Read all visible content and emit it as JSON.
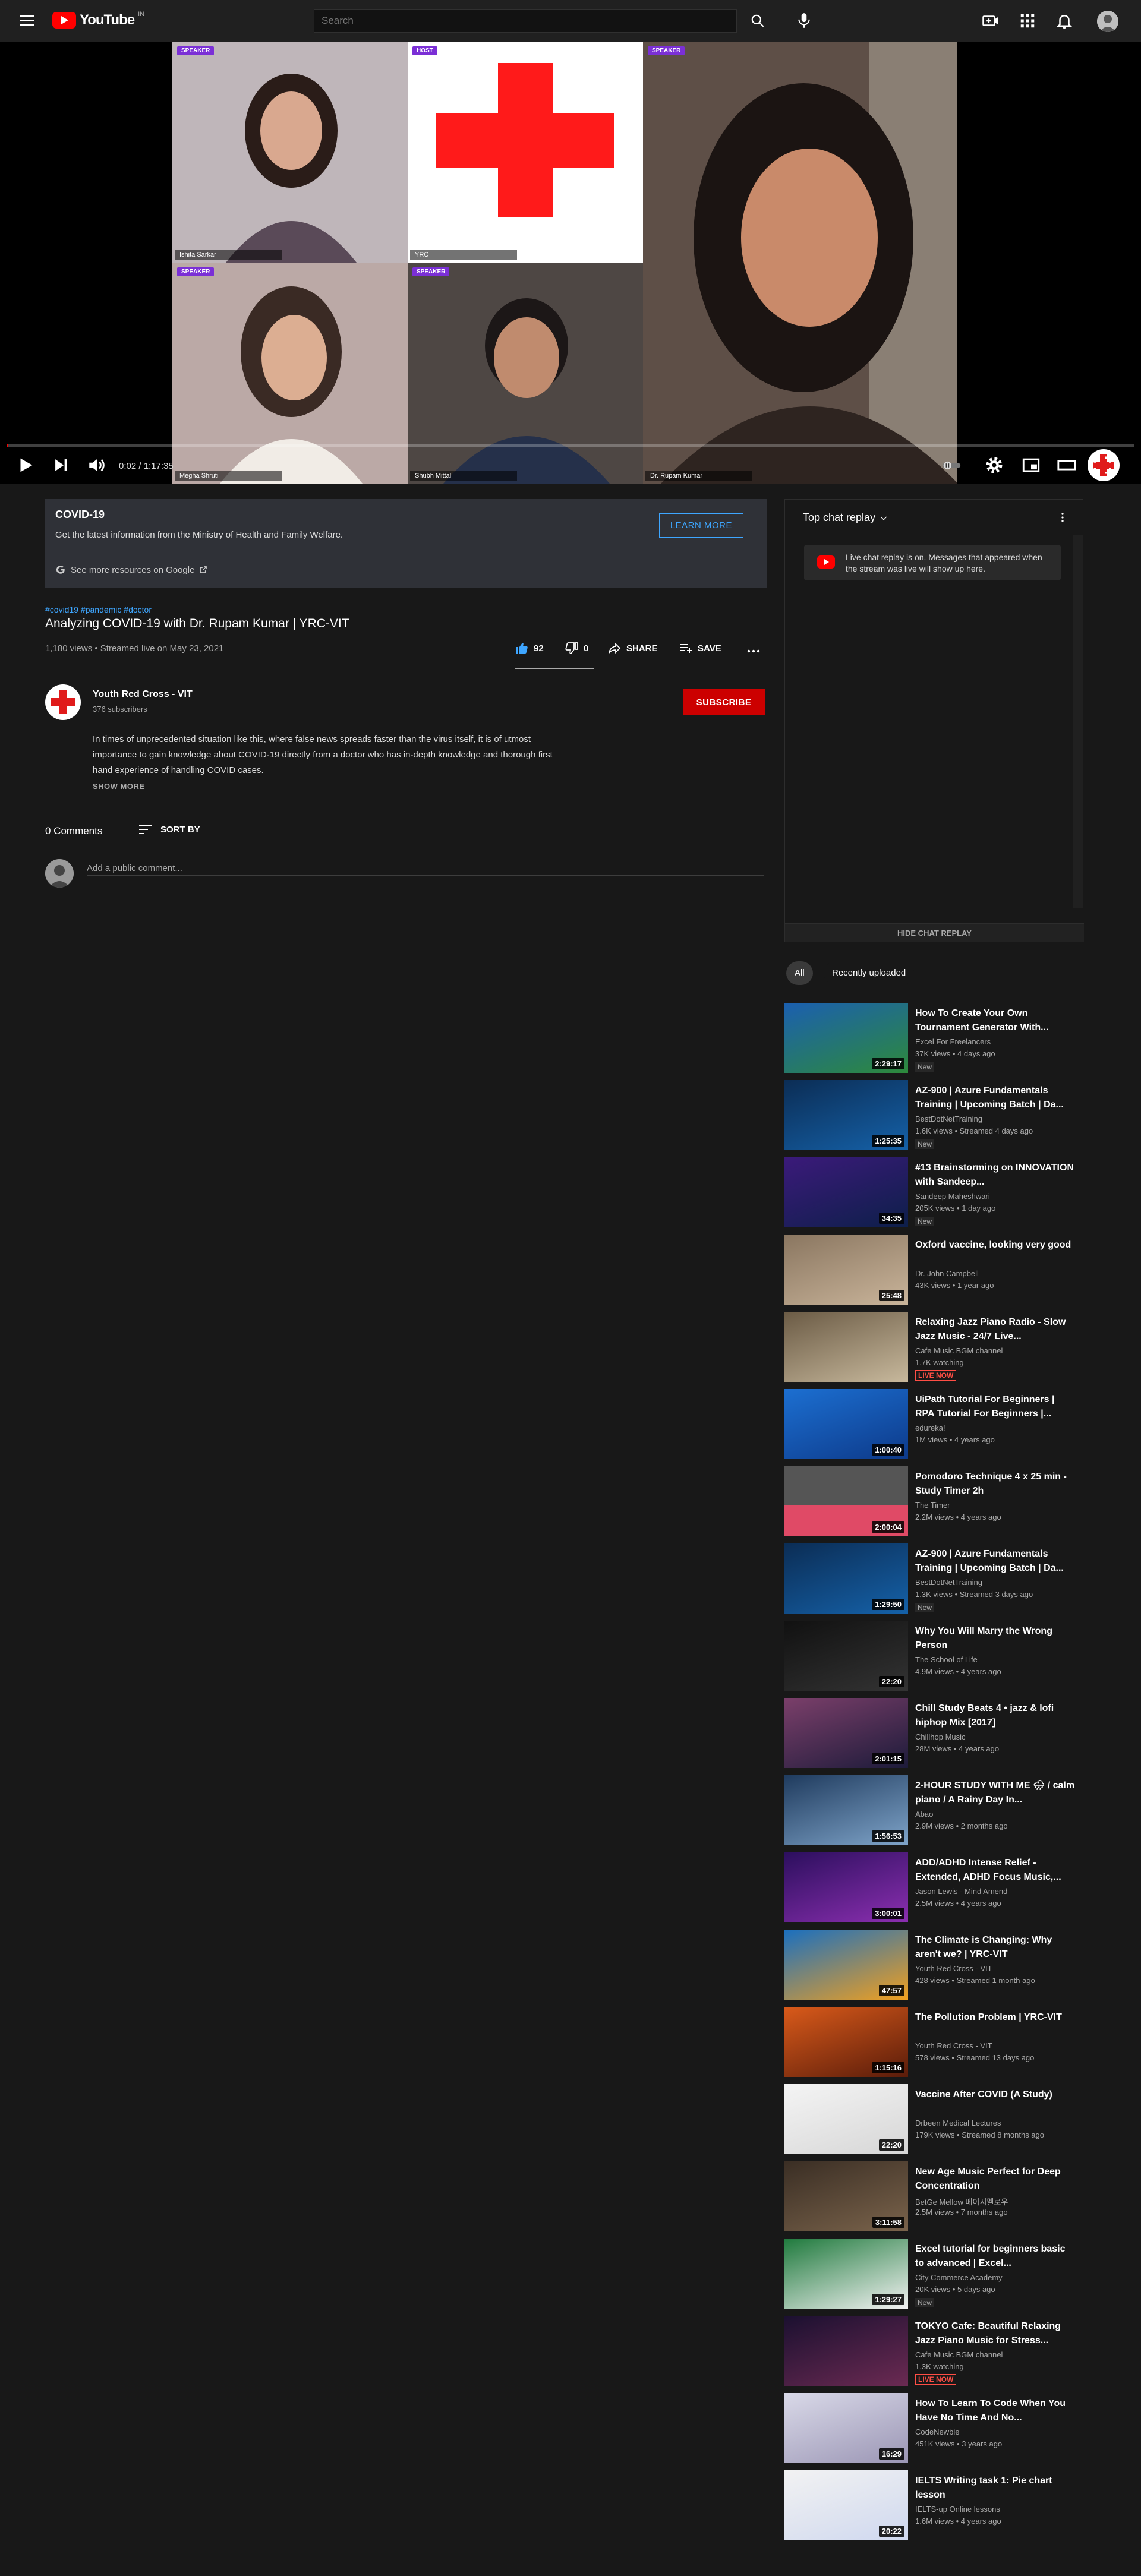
{
  "header": {
    "logo_text": "YouTube",
    "country_code": "IN",
    "search_placeholder": "Search"
  },
  "player": {
    "tiles": [
      {
        "badge": "SPEAKER",
        "name": "Ishita Sarkar"
      },
      {
        "badge": "HOST",
        "name": "YRC"
      },
      {
        "badge": "SPEAKER",
        "name": "Dr. Rupam Kumar"
      },
      {
        "badge": "SPEAKER",
        "name": "Megha Shruti"
      },
      {
        "badge": "SPEAKER",
        "name": "Shubh Mittal"
      }
    ],
    "time": "0:02 / 1:17:35",
    "progress_fraction": 0.0004
  },
  "covid_panel": {
    "title": "COVID-19",
    "description": "Get the latest information from the Ministry of Health and Family Welfare.",
    "button": "LEARN MORE",
    "google_link": "See more resources on Google"
  },
  "video": {
    "hashtags": "#covid19 #pandemic #doctor",
    "title": "Analyzing COVID-19 with Dr. Rupam Kumar | YRC-VIT",
    "views": "1,180 views • Streamed live on May 23, 2021",
    "likes": "92",
    "dislikes": "0",
    "share": "SHARE",
    "save": "SAVE",
    "like_ratio": 1.0
  },
  "channel": {
    "name": "Youth Red Cross - VIT",
    "subscribers": "376 subscribers",
    "subscribe": "SUBSCRIBE",
    "description": "In times of unprecedented situation like this, where false news spreads faster than the virus itself, it is of utmost importance to gain knowledge about COVID-19 directly from a doctor who has in-depth knowledge and thorough first hand experience of handling COVID cases.",
    "show_more": "SHOW MORE"
  },
  "comments": {
    "count": "0 Comments",
    "sort_by": "SORT BY",
    "placeholder": "Add a public comment..."
  },
  "chat": {
    "title": "Top chat replay",
    "notice": "Live chat replay is on. Messages that appeared when the stream was live will show up here.",
    "hide": "HIDE CHAT REPLAY"
  },
  "chips": {
    "all": "All",
    "recent": "Recently uploaded"
  },
  "recommendations": [
    {
      "title": "How To Create Your Own Tournament Generator With...",
      "channel": "Excel For Freelancers",
      "meta": "37K views • 4 days ago",
      "tag": "New",
      "duration": "2:29:17"
    },
    {
      "title": "AZ-900 | Azure Fundamentals Training | Upcoming Batch | Da...",
      "channel": "BestDotNetTraining",
      "meta": "1.6K views • Streamed 4 days ago",
      "tag": "New",
      "duration": "1:25:35"
    },
    {
      "title": "#13 Brainstorming on INNOVATION with Sandeep...",
      "channel": "Sandeep Maheshwari",
      "meta": "205K views • 1 day ago",
      "tag": "New",
      "duration": "34:35"
    },
    {
      "title": "Oxford vaccine, looking very good",
      "channel": "Dr. John Campbell",
      "meta": "43K views • 1 year ago",
      "tag": "",
      "duration": "25:48"
    },
    {
      "title": "Relaxing Jazz Piano Radio - Slow Jazz Music - 24/7 Live...",
      "channel": "Cafe Music BGM channel",
      "meta": "1.7K watching",
      "tag": "LIVE NOW",
      "duration": ""
    },
    {
      "title": "UiPath Tutorial For Beginners | RPA Tutorial For Beginners |...",
      "channel": "edureka!",
      "meta": "1M views • 4 years ago",
      "tag": "",
      "duration": "1:00:40"
    },
    {
      "title": "Pomodoro Technique 4 x 25 min - Study Timer 2h",
      "channel": "The Timer",
      "meta": "2.2M views • 4 years ago",
      "tag": "",
      "duration": "2:00:04"
    },
    {
      "title": "AZ-900 | Azure Fundamentals Training | Upcoming Batch | Da...",
      "channel": "BestDotNetTraining",
      "meta": "1.3K views • Streamed 3 days ago",
      "tag": "New",
      "duration": "1:29:50"
    },
    {
      "title": "Why You Will Marry the Wrong Person",
      "channel": "The School of Life",
      "meta": "4.9M views • 4 years ago",
      "tag": "",
      "duration": "22:20"
    },
    {
      "title": "Chill Study Beats 4 • jazz & lofi hiphop Mix [2017]",
      "channel": "Chillhop Music",
      "meta": "28M views • 4 years ago",
      "tag": "",
      "duration": "2:01:15"
    },
    {
      "title": "2-HOUR STUDY WITH ME 🌧 / calm piano / A Rainy Day In...",
      "channel": "Abao",
      "meta": "2.9M views • 2 months ago",
      "tag": "",
      "duration": "1:56:53"
    },
    {
      "title": "ADD/ADHD Intense Relief - Extended, ADHD Focus Music,...",
      "channel": "Jason Lewis - Mind Amend",
      "meta": "2.5M views • 4 years ago",
      "tag": "",
      "duration": "3:00:01"
    },
    {
      "title": "The Climate is Changing: Why aren't we? | YRC-VIT",
      "channel": "Youth Red Cross - VIT",
      "meta": "428 views • Streamed 1 month ago",
      "tag": "",
      "duration": "47:57"
    },
    {
      "title": "The Pollution Problem | YRC-VIT",
      "channel": "Youth Red Cross - VIT",
      "meta": "578 views • Streamed 13 days ago",
      "tag": "",
      "duration": "1:15:16"
    },
    {
      "title": "Vaccine After COVID (A Study)",
      "channel": "Drbeen Medical Lectures",
      "meta": "179K views • Streamed 8 months ago",
      "tag": "",
      "duration": "22:20"
    },
    {
      "title": "New Age Music Perfect for Deep Concentration",
      "channel": "BetGe Mellow 베이지멜로우",
      "meta": "2.5M views • 7 months ago",
      "tag": "",
      "duration": "3:11:58"
    },
    {
      "title": "Excel tutorial for beginners basic to advanced | Excel...",
      "channel": "City Commerce Academy",
      "meta": "20K views • 5 days ago",
      "tag": "New",
      "duration": "1:29:27"
    },
    {
      "title": "TOKYO Cafe: Beautiful Relaxing Jazz Piano Music for Stress...",
      "channel": "Cafe Music BGM channel",
      "meta": "1.3K watching",
      "tag": "LIVE NOW",
      "duration": ""
    },
    {
      "title": "How To Learn To Code When You Have No Time And No...",
      "channel": "CodeNewbie",
      "meta": "451K views • 3 years ago",
      "tag": "",
      "duration": "16:29"
    },
    {
      "title": "IELTS Writing task 1: Pie chart lesson",
      "channel": "IELTS-up Online lessons",
      "meta": "1.6M views • 4 years ago",
      "tag": "",
      "duration": "20:22"
    }
  ]
}
